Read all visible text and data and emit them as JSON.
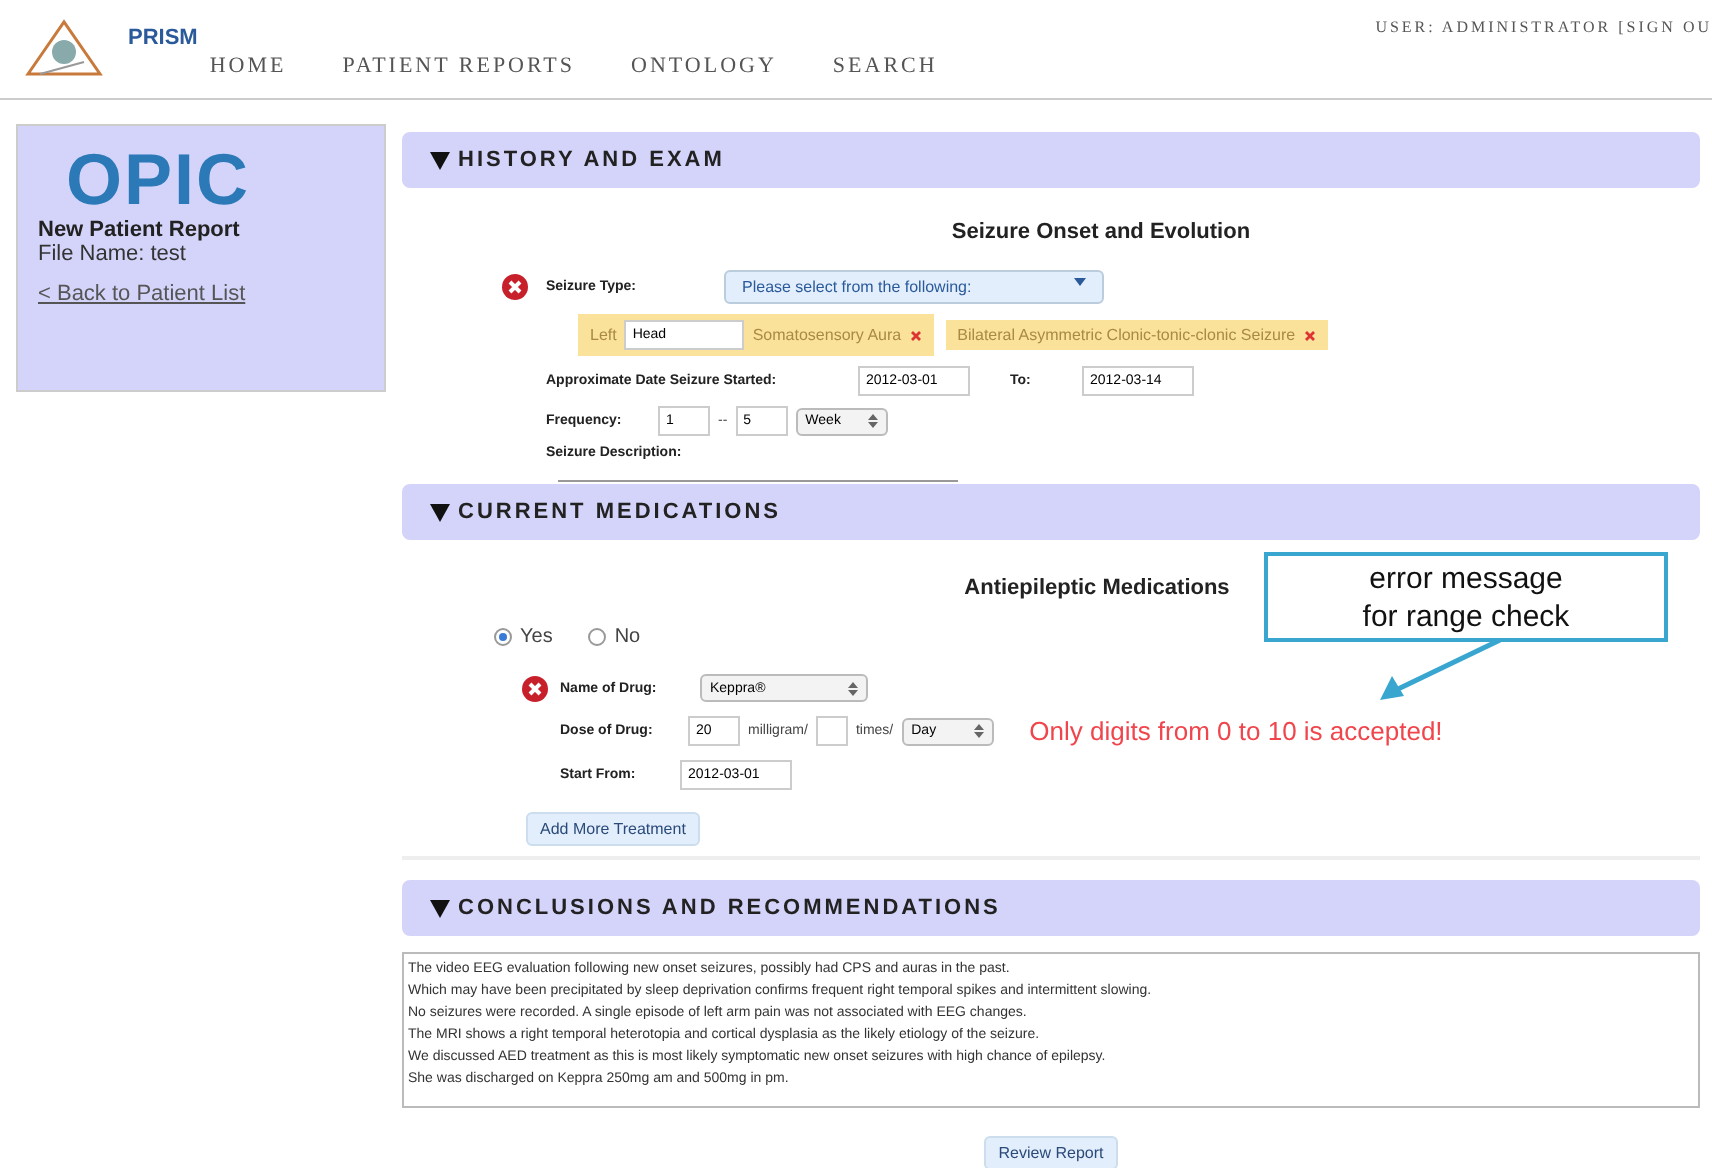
{
  "header": {
    "brand": "PRISM",
    "nav": [
      {
        "label": "HOME",
        "selected": false
      },
      {
        "label": "PATIENT REPORTS",
        "selected": false
      },
      {
        "label": "ONTOLOGY",
        "selected": false
      },
      {
        "label": "SEARCH",
        "selected": false
      }
    ],
    "user": "USER: ADMINISTRATOR [SIGN OU"
  },
  "sidebar": {
    "logo": "OPIC",
    "title": "New Patient Report",
    "file_name": "File Name: test",
    "back_link": "< Back to Patient List"
  },
  "history": {
    "title": "HISTORY AND EXAM",
    "expanded": true,
    "subtitle": "Seizure Onset and Evolution",
    "seizure_type": {
      "label": "Seizure Type:",
      "error": true,
      "select": "Please select from the following:"
    },
    "tags": [
      {
        "prefix": "Left",
        "input": "Head",
        "label": "Somatosensory Aura"
      },
      {
        "label": "Bilateral Asymmetric Clonic-tonic-clonic Seizure"
      }
    ],
    "date_label": "Approximate Date Seizure Started:",
    "date_from": "2012-03-01",
    "to_label": "To:",
    "date_to": "2012-03-14",
    "frequency_label": "Frequency:",
    "freq_min": "1",
    "freq_sep": "--",
    "freq_max": "5",
    "freq_unit": "Week",
    "description_label": "Seizure Description:"
  },
  "medications": {
    "title": "CURRENT MEDICATIONS",
    "expanded": true,
    "subtitle": "Antiepileptic Medications",
    "options": [
      {
        "label": "Yes",
        "selected": true
      },
      {
        "label": "No",
        "selected": false
      }
    ],
    "drug_label": "Name of Drug:",
    "drug_error": true,
    "drug": "Keppra®",
    "dose_label": "Dose of Drug:",
    "dose": "20",
    "dose_unit": "milligram/",
    "times_unit": "times/",
    "period": "Day",
    "start_label": "Start From:",
    "start": "2012-03-01",
    "add_button": "Add More Treatment",
    "error_message": "Only digits from 0 to 10 is accepted!"
  },
  "annotation": {
    "lines": [
      "error message",
      "for range check"
    ]
  },
  "conclusions": {
    "title": "CONCLUSIONS AND RECOMMENDATIONS",
    "expanded": true,
    "text": [
      "The video EEG evaluation following new onset seizures, possibly had CPS and auras in the past.",
      "Which may have been precipitated by sleep deprivation confirms frequent right temporal spikes and intermittent slowing.",
      "No seizures were recorded. A single episode of left arm pain was not associated with EEG changes.",
      "The MRI shows a right temporal heterotopia and cortical dysplasia as the likely etiology of the seizure.",
      "We discussed AED treatment as this is most likely symptomatic new onset seizures with high chance of epilepsy.",
      "She was discharged on Keppra 250mg am and 500mg in pm."
    ],
    "review_button": "Review Report"
  }
}
